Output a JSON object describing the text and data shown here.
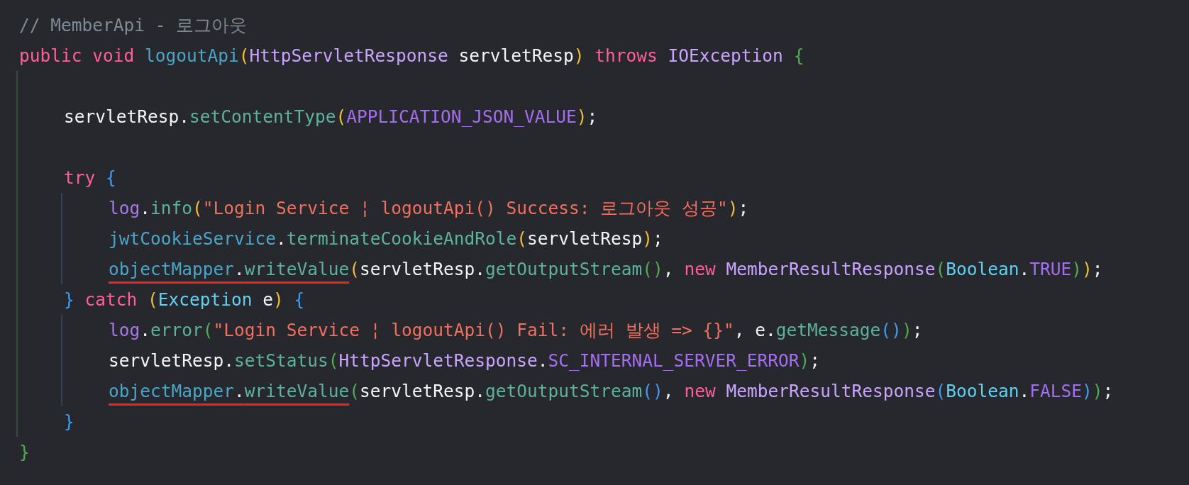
{
  "code": [
    {
      "kind": "code",
      "tokens": [
        {
          "text": "// MemberApi - 로그아웃",
          "kind": "comment"
        }
      ]
    },
    {
      "kind": "code",
      "tokens": [
        {
          "text": "public void ",
          "kind": "keyword"
        },
        {
          "text": "logoutApi",
          "kind": "variable"
        },
        {
          "text": "(",
          "kind": "paren-yellow"
        },
        {
          "text": "HttpServletResponse",
          "kind": "type"
        },
        {
          "text": " servletResp",
          "kind": "plain"
        },
        {
          "text": ") ",
          "kind": "paren-yellow"
        },
        {
          "text": "throws ",
          "kind": "keyword"
        },
        {
          "text": "IOException ",
          "kind": "type"
        },
        {
          "text": "{",
          "kind": "paren-green"
        }
      ],
      "children": [
        {
          "kind": "blank"
        },
        {
          "kind": "code",
          "tokens": [
            {
              "text": "servletResp.",
              "kind": "plain"
            },
            {
              "text": "setContentType",
              "kind": "method"
            },
            {
              "text": "(",
              "kind": "paren-yellow"
            },
            {
              "text": "APPLICATION_JSON_VALUE",
              "kind": "constant"
            },
            {
              "text": ")",
              "kind": "paren-yellow"
            },
            {
              "text": ";",
              "kind": "plain"
            }
          ]
        },
        {
          "kind": "blank"
        },
        {
          "kind": "code",
          "tokens": [
            {
              "text": "try ",
              "kind": "keyword"
            },
            {
              "text": "{",
              "kind": "paren-blue"
            }
          ],
          "children": [
            {
              "kind": "code",
              "tokens": [
                {
                  "text": "log",
                  "kind": "field"
                },
                {
                  "text": ".",
                  "kind": "plain"
                },
                {
                  "text": "info",
                  "kind": "method"
                },
                {
                  "text": "(",
                  "kind": "paren-yellow"
                },
                {
                  "text": "\"Login Service ¦ logoutApi() Success: 로그아웃 성공\"",
                  "kind": "string"
                },
                {
                  "text": ")",
                  "kind": "paren-yellow"
                },
                {
                  "text": ";",
                  "kind": "plain"
                }
              ]
            },
            {
              "kind": "code",
              "tokens": [
                {
                  "text": "jwtCookieService",
                  "kind": "variable"
                },
                {
                  "text": ".",
                  "kind": "plain"
                },
                {
                  "text": "terminateCookieAndRole",
                  "kind": "method"
                },
                {
                  "text": "(",
                  "kind": "paren-yellow"
                },
                {
                  "text": "servletResp",
                  "kind": "plain"
                },
                {
                  "text": ")",
                  "kind": "paren-yellow"
                },
                {
                  "text": ";",
                  "kind": "plain"
                }
              ]
            },
            {
              "kind": "code",
              "tokens": [
                {
                  "text": "objectMapper",
                  "kind": "variable",
                  "underlined": true
                },
                {
                  "text": ".",
                  "kind": "plain",
                  "underlined": true
                },
                {
                  "text": "writeValue",
                  "kind": "method",
                  "underlined": true
                },
                {
                  "text": "(",
                  "kind": "paren-yellow"
                },
                {
                  "text": "servletResp.",
                  "kind": "plain"
                },
                {
                  "text": "getOutputStream",
                  "kind": "method"
                },
                {
                  "text": "()",
                  "kind": "paren-green"
                },
                {
                  "text": ", ",
                  "kind": "plain"
                },
                {
                  "text": "new ",
                  "kind": "keyword"
                },
                {
                  "text": "MemberResultResponse",
                  "kind": "type"
                },
                {
                  "text": "(",
                  "kind": "paren-green"
                },
                {
                  "text": "Boolean",
                  "kind": "class"
                },
                {
                  "text": ".",
                  "kind": "plain"
                },
                {
                  "text": "TRUE",
                  "kind": "constant"
                },
                {
                  "text": ")",
                  "kind": "paren-green"
                },
                {
                  "text": ")",
                  "kind": "paren-yellow"
                },
                {
                  "text": ";",
                  "kind": "plain"
                }
              ]
            }
          ]
        },
        {
          "kind": "code",
          "tokens": [
            {
              "text": "} ",
              "kind": "paren-blue"
            },
            {
              "text": "catch ",
              "kind": "keyword"
            },
            {
              "text": "(",
              "kind": "paren-yellow"
            },
            {
              "text": "Exception",
              "kind": "class"
            },
            {
              "text": " e",
              "kind": "plain"
            },
            {
              "text": ") ",
              "kind": "paren-yellow"
            },
            {
              "text": "{",
              "kind": "paren-blue"
            }
          ],
          "children": [
            {
              "kind": "code",
              "tokens": [
                {
                  "text": "log",
                  "kind": "field"
                },
                {
                  "text": ".",
                  "kind": "plain"
                },
                {
                  "text": "error",
                  "kind": "method"
                },
                {
                  "text": "(",
                  "kind": "paren-green"
                },
                {
                  "text": "\"Login Service ¦ logoutApi() Fail: 에러 발생 => {}\"",
                  "kind": "string"
                },
                {
                  "text": ", e.",
                  "kind": "plain"
                },
                {
                  "text": "getMessage",
                  "kind": "method"
                },
                {
                  "text": "()",
                  "kind": "paren-blue"
                },
                {
                  "text": ")",
                  "kind": "paren-green"
                },
                {
                  "text": ";",
                  "kind": "plain"
                }
              ]
            },
            {
              "kind": "code",
              "tokens": [
                {
                  "text": "servletResp.",
                  "kind": "plain"
                },
                {
                  "text": "setStatus",
                  "kind": "method"
                },
                {
                  "text": "(",
                  "kind": "paren-green"
                },
                {
                  "text": "HttpServletResponse",
                  "kind": "type"
                },
                {
                  "text": ".",
                  "kind": "plain"
                },
                {
                  "text": "SC_INTERNAL_SERVER_ERROR",
                  "kind": "constant"
                },
                {
                  "text": ")",
                  "kind": "paren-green"
                },
                {
                  "text": ";",
                  "kind": "plain"
                }
              ]
            },
            {
              "kind": "code",
              "tokens": [
                {
                  "text": "objectMapper",
                  "kind": "variable",
                  "underlined": true
                },
                {
                  "text": ".",
                  "kind": "plain",
                  "underlined": true
                },
                {
                  "text": "writeValue",
                  "kind": "method",
                  "underlined": true
                },
                {
                  "text": "(",
                  "kind": "paren-green"
                },
                {
                  "text": "servletResp.",
                  "kind": "plain"
                },
                {
                  "text": "getOutputStream",
                  "kind": "method"
                },
                {
                  "text": "()",
                  "kind": "paren-blue"
                },
                {
                  "text": ", ",
                  "kind": "plain"
                },
                {
                  "text": "new ",
                  "kind": "keyword"
                },
                {
                  "text": "MemberResultResponse",
                  "kind": "type"
                },
                {
                  "text": "(",
                  "kind": "paren-blue"
                },
                {
                  "text": "Boolean",
                  "kind": "class"
                },
                {
                  "text": ".",
                  "kind": "plain"
                },
                {
                  "text": "FALSE",
                  "kind": "constant"
                },
                {
                  "text": ")",
                  "kind": "paren-blue"
                },
                {
                  "text": ")",
                  "kind": "paren-green"
                },
                {
                  "text": ";",
                  "kind": "plain"
                }
              ]
            }
          ]
        },
        {
          "kind": "code",
          "tokens": [
            {
              "text": "}",
              "kind": "paren-blue"
            }
          ]
        }
      ]
    },
    {
      "kind": "code",
      "tokens": [
        {
          "text": "}",
          "kind": "paren-green"
        }
      ]
    }
  ]
}
